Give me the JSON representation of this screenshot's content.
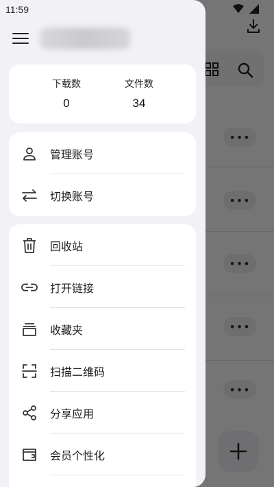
{
  "status_bar": {
    "time": "11:59"
  },
  "stats": {
    "downloads_label": "下载数",
    "downloads_value": "0",
    "files_label": "文件数",
    "files_value": "34"
  },
  "account_menu": [
    {
      "label": "管理账号",
      "icon": "person-icon"
    },
    {
      "label": "切换账号",
      "icon": "swap-icon"
    }
  ],
  "tools_menu": [
    {
      "label": "回收站",
      "icon": "trash-icon"
    },
    {
      "label": "打开链接",
      "icon": "link-icon"
    },
    {
      "label": "收藏夹",
      "icon": "favorites-icon"
    },
    {
      "label": "扫描二维码",
      "icon": "scan-icon"
    },
    {
      "label": "分享应用",
      "icon": "share-icon"
    },
    {
      "label": "会员个性化",
      "icon": "wallet-icon"
    }
  ],
  "background": {
    "more_label": "•••",
    "colors": {
      "scrim": "#000000",
      "drawer": "#f2f1f6",
      "card": "#ffffff"
    }
  }
}
